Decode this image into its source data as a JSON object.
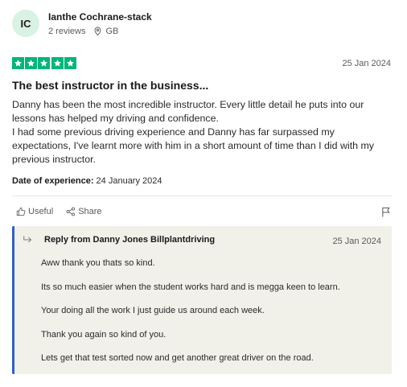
{
  "reviewer": {
    "initials": "IC",
    "name": "Ianthe Cochrane-stack",
    "reviews": "2 reviews",
    "country": "GB"
  },
  "review": {
    "rating": 5,
    "rating_max": 5,
    "date": "25 Jan 2024",
    "title": "The best instructor in the business...",
    "body_lines": [
      "Danny has been the most incredible instructor. Every little detail he puts into our lessons has helped my driving and confidence.",
      "I had some previous driving experience and Danny has far surpassed my expectations, I've learnt more with him in a short amount of time than I did with my previous instructor."
    ],
    "experience_label": "Date of experience:",
    "experience_date": "24 January 2024"
  },
  "actions": {
    "useful": "Useful",
    "share": "Share"
  },
  "reply": {
    "from": "Reply from Danny Jones Billplantdriving",
    "date": "25 Jan 2024",
    "lines": [
      "Aww thank you thats so kind.",
      "Its so much easier when the student works hard and is megga keen to learn.",
      "Your doing all the work I just guide us around each week.",
      "Thank you again so kind of you.",
      "Lets get that test sorted now and get another great driver on the road."
    ]
  },
  "colors": {
    "star_green": "#00b67a",
    "reply_accent": "#2d5fcc",
    "reply_bg": "#f1f1ea",
    "avatar_bg": "#d9f2e4"
  },
  "icons": [
    "location-pin-icon",
    "star-icon",
    "thumbs-up-icon",
    "share-icon",
    "flag-icon",
    "reply-arrow-icon"
  ]
}
